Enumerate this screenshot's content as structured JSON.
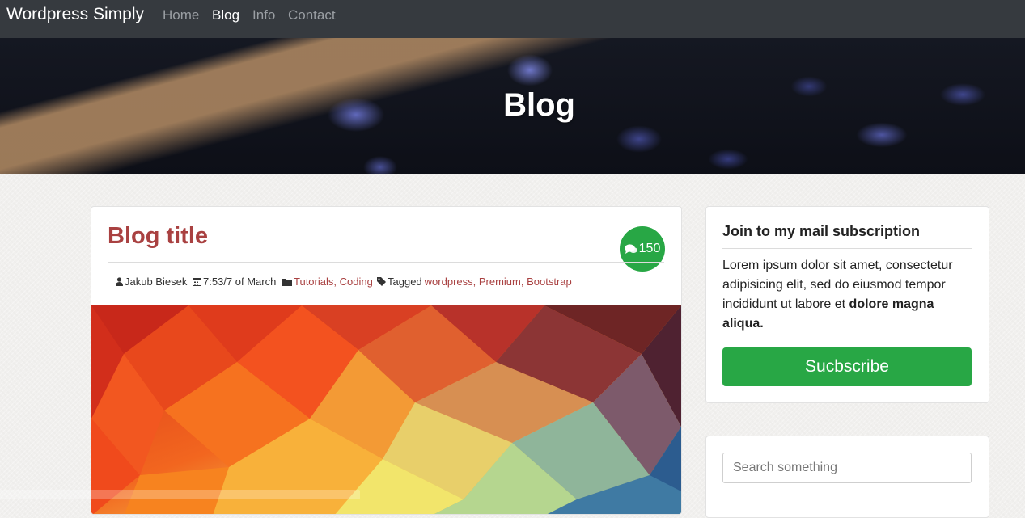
{
  "navbar": {
    "brand": "Wordpress Simply",
    "links": [
      {
        "label": "Home",
        "active": false
      },
      {
        "label": "Blog",
        "active": true
      },
      {
        "label": "Info",
        "active": false
      },
      {
        "label": "Contact",
        "active": false
      }
    ]
  },
  "hero": {
    "title": "Blog"
  },
  "post": {
    "title": "Blog title",
    "comment_count": "150",
    "author": "Jakub Biesek",
    "datetime": "7:53/7 of March",
    "categories": [
      "Tutorials",
      "Coding"
    ],
    "tagged_label": "Tagged",
    "tags": [
      "wordpress",
      "Premium",
      "Bootstrap"
    ],
    "separator": ", "
  },
  "subscription": {
    "heading": "Join to my mail subscription",
    "text_plain": "Lorem ipsum dolor sit amet, consectetur adipisicing elit, sed do eiusmod tempor incididunt ut labore et ",
    "text_bold": "dolore magna aliqua.",
    "button_label": "Sucbscribe"
  },
  "search": {
    "placeholder": "Search something"
  },
  "colors": {
    "accent_red": "#a94141",
    "accent_green": "#28a745",
    "navbar_bg": "#363a3f"
  },
  "icons": {
    "comments": "comments-icon",
    "author": "user-icon",
    "date": "calendar-icon",
    "category": "folder-icon",
    "tag": "tag-icon"
  }
}
